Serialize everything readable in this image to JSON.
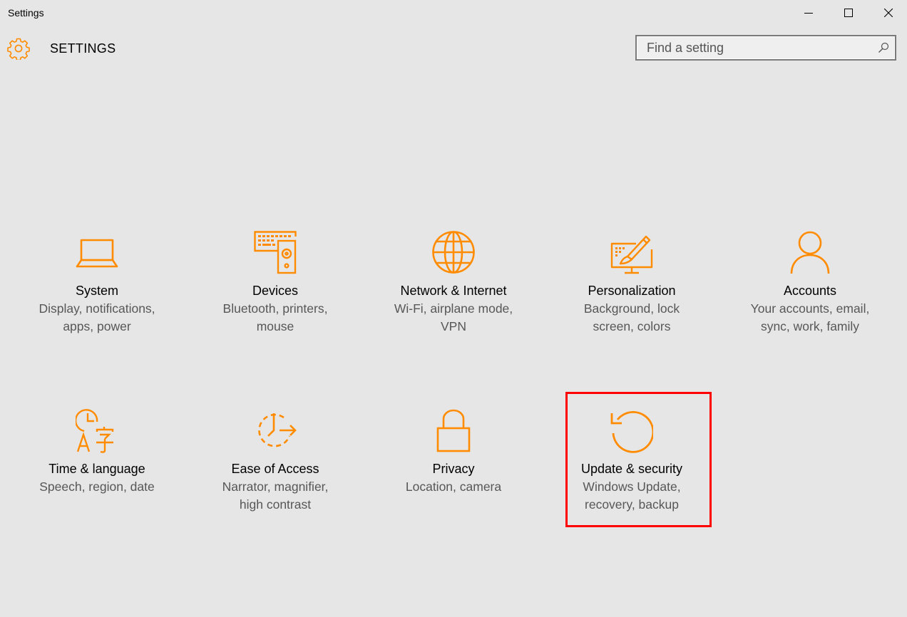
{
  "window": {
    "title": "Settings",
    "controls": {
      "minimize_icon": "minimize-icon",
      "maximize_icon": "maximize-icon",
      "close_icon": "close-icon"
    }
  },
  "header": {
    "icon": "gear-icon",
    "title": "SETTINGS"
  },
  "search": {
    "placeholder": "Find a setting",
    "value": "",
    "icon": "search-icon"
  },
  "accent_color": "#ff8c00",
  "highlight_color": "#ff0000",
  "tiles": [
    {
      "label": "System",
      "desc_line1": "Display, notifications,",
      "desc_line2": "apps, power",
      "icon": "laptop-icon"
    },
    {
      "label": "Devices",
      "desc_line1": "Bluetooth, printers,",
      "desc_line2": "mouse",
      "icon": "keyboard-speaker-icon"
    },
    {
      "label": "Network & Internet",
      "desc_line1": "Wi-Fi, airplane mode,",
      "desc_line2": "VPN",
      "icon": "globe-icon"
    },
    {
      "label": "Personalization",
      "desc_line1": "Background, lock",
      "desc_line2": "screen, colors",
      "icon": "paintbrush-monitor-icon"
    },
    {
      "label": "Accounts",
      "desc_line1": "Your accounts, email,",
      "desc_line2": "sync, work, family",
      "icon": "person-icon"
    },
    {
      "label": "Time & language",
      "desc_line1": "Speech, region, date",
      "desc_line2": "",
      "icon": "clock-language-icon"
    },
    {
      "label": "Ease of Access",
      "desc_line1": "Narrator, magnifier,",
      "desc_line2": "high contrast",
      "icon": "ease-of-access-icon"
    },
    {
      "label": "Privacy",
      "desc_line1": "Location, camera",
      "desc_line2": "",
      "icon": "lock-icon"
    },
    {
      "label": "Update & security",
      "desc_line1": "Windows Update,",
      "desc_line2": "recovery, backup",
      "icon": "refresh-icon"
    }
  ]
}
